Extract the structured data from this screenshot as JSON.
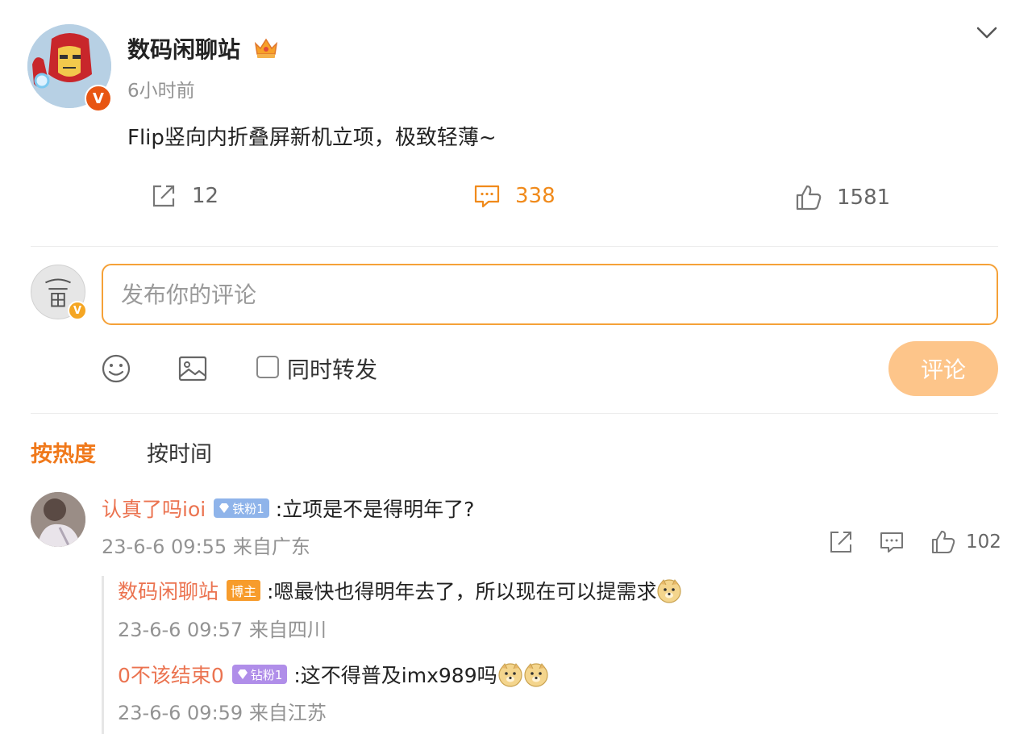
{
  "post": {
    "author": "数码闲聊站",
    "time": "6小时前",
    "text": "Flip竖向内折叠屏新机立项，极致轻薄~",
    "verified_mark": "V",
    "reposts": "12",
    "comments": "338",
    "likes": "1581"
  },
  "composer": {
    "placeholder": "发布你的评论",
    "verified_mark": "V",
    "repost_label": "同时转发",
    "submit_label": "评论"
  },
  "sort": {
    "hot": "按热度",
    "time": "按时间"
  },
  "comment": {
    "author": "认真了吗ioi",
    "badge": "铁粉1",
    "text": ":立项是不是得明年了?",
    "meta": "23-6-6 09:55 来自广东",
    "likes": "102"
  },
  "replies": [
    {
      "author": "数码闲聊站",
      "badge": "博主",
      "text": ":嗯最快也得明年去了，所以现在可以提需求",
      "meta": "23-6-6 09:57 来自四川"
    },
    {
      "author": "0不该结束0",
      "badge": "钻粉1",
      "text": ":这不得普及imx989吗",
      "meta": "23-6-6 09:59 来自江苏"
    }
  ],
  "colors": {
    "accent": "#f08a1b",
    "name": "#eb7350",
    "submit_disabled": "#fdc58a",
    "input_border": "#f5a138"
  }
}
